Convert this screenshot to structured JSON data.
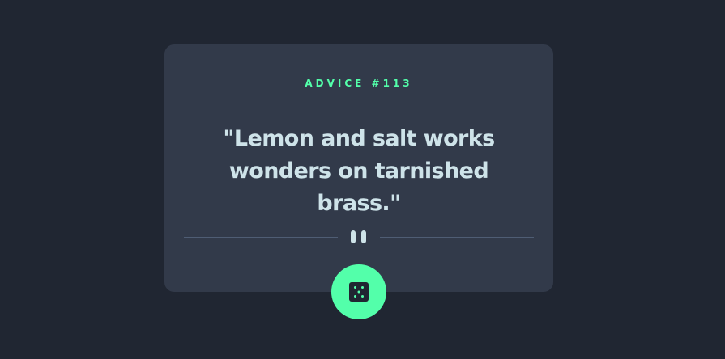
{
  "card": {
    "advice_label": "ADVICE #113",
    "quote": "\"Lemon and salt works wonders on tarnished brass.\""
  },
  "divider": {
    "icon": "pause-icon"
  },
  "button": {
    "icon": "dice-icon"
  },
  "colors": {
    "background": "#202632",
    "card": "#323a4a",
    "accent": "#53ffaa",
    "text": "#cee3e9",
    "divider": "#4f5d74"
  }
}
